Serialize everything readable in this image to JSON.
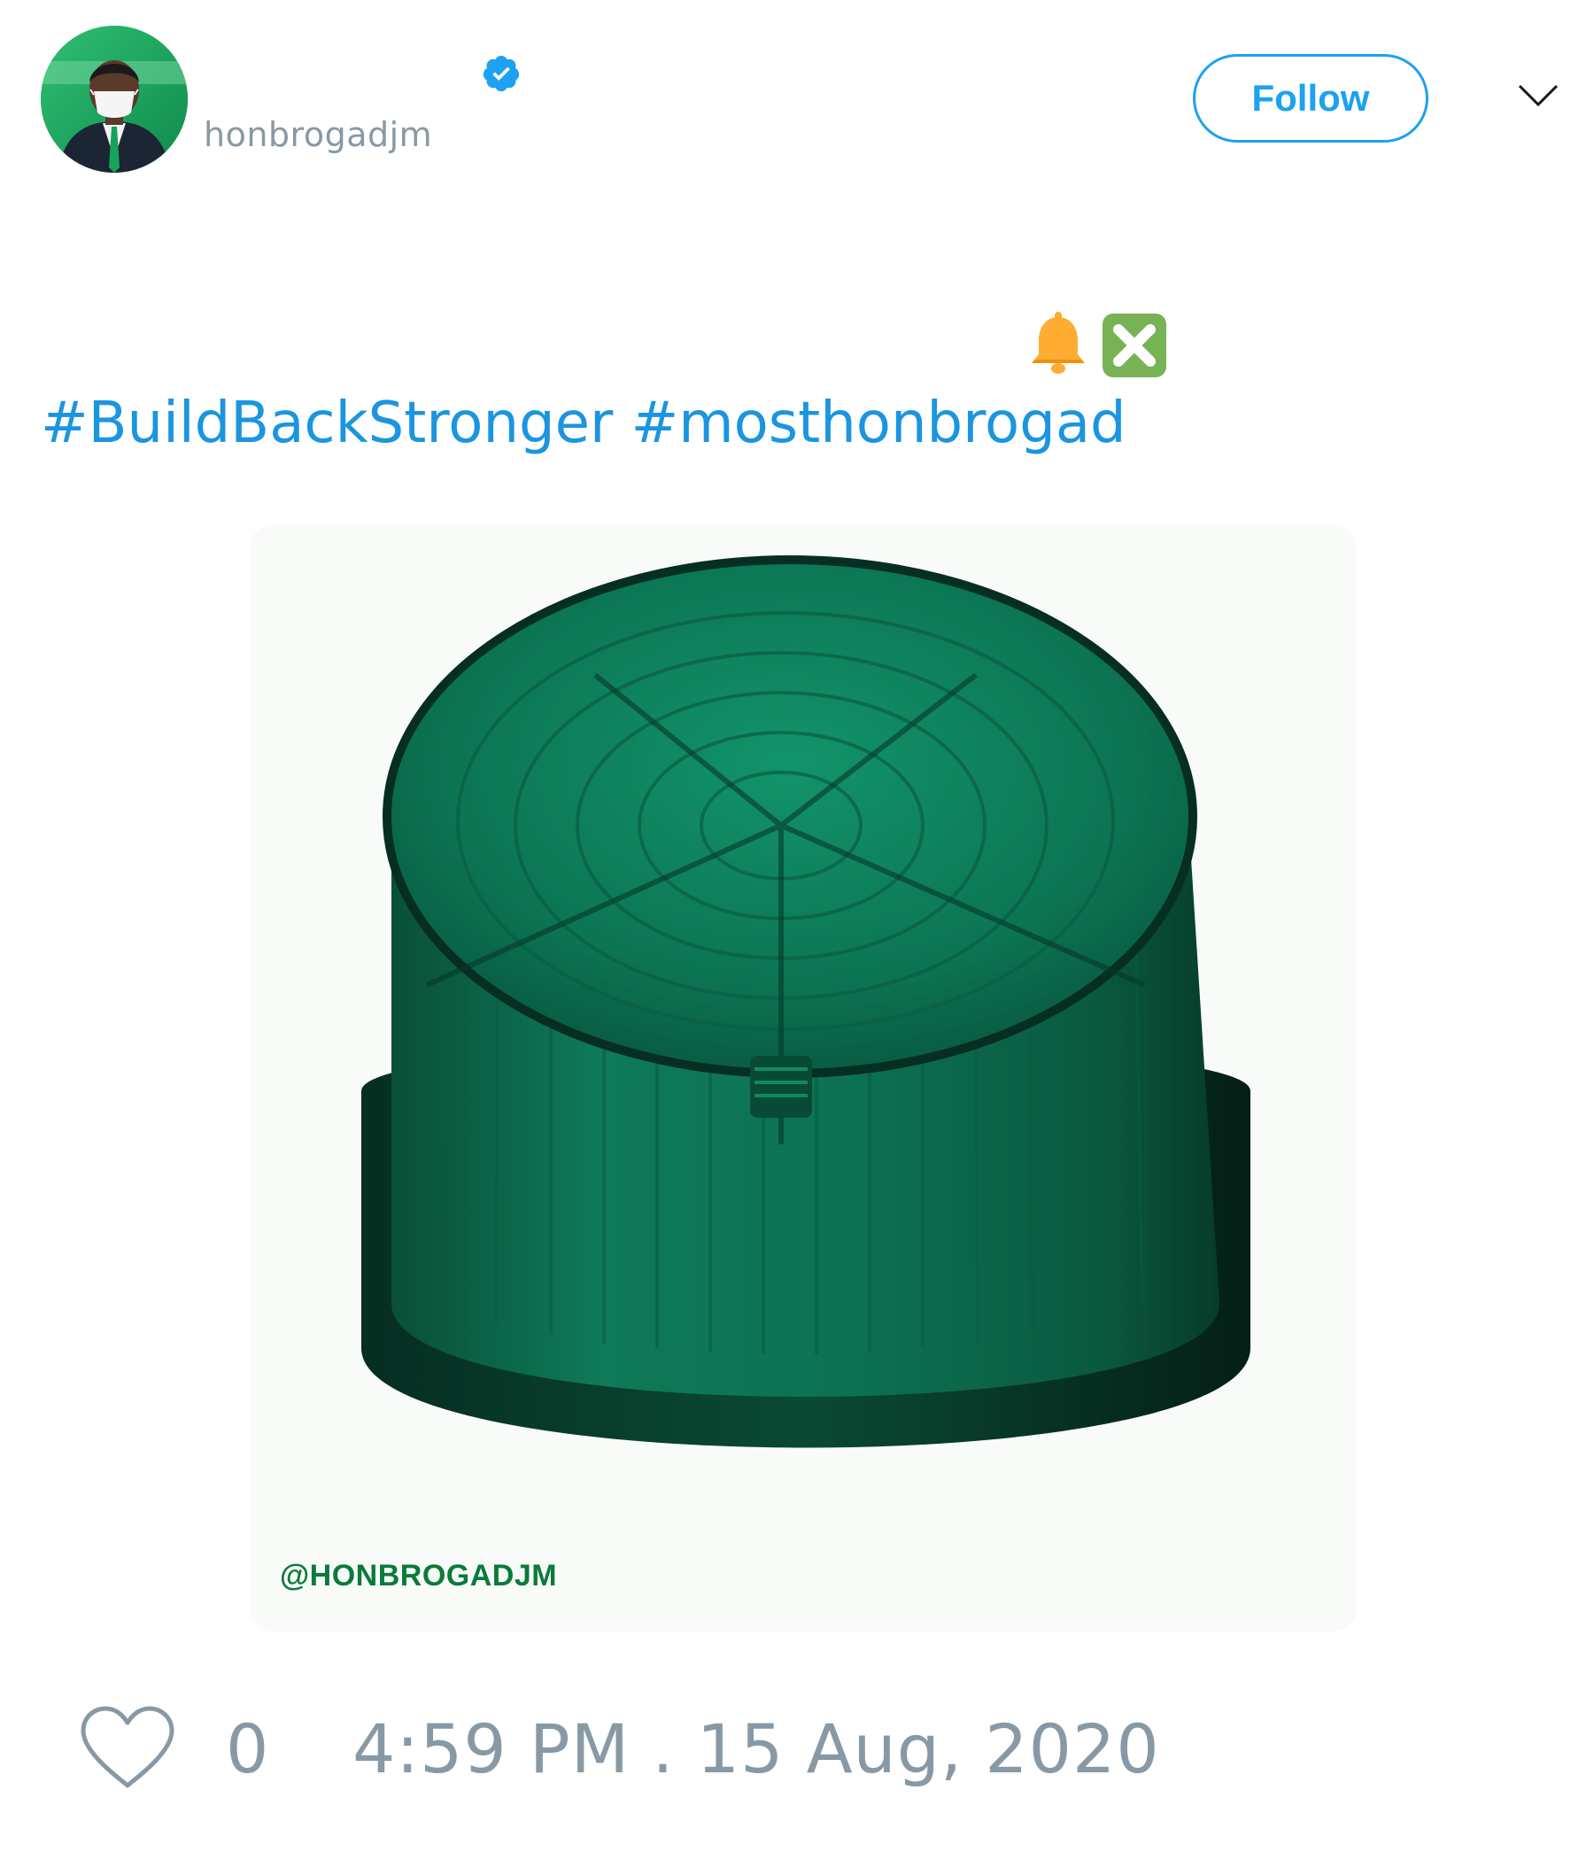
{
  "author": {
    "display_name": "",
    "handle": "honbrogadjm",
    "verified": true,
    "avatar_icon": "avatar-photo"
  },
  "follow_label": "Follow",
  "tweet": {
    "emojis": [
      "bell-icon",
      "cross-mark-icon"
    ],
    "hashtags": [
      "#BuildBackStronger",
      "#mosthonbrogad"
    ]
  },
  "media": {
    "watermark": "@HONBROGADJM",
    "subject_icon": "green-beacon-light"
  },
  "footer": {
    "like_count": "0",
    "timestamp": "4:59 PM . 15 Aug, 2020"
  },
  "colors": {
    "accent": "#1da1f2",
    "hashtag": "#1b95e0",
    "muted": "#8899a6",
    "beacon_green": "#0b7a50"
  }
}
